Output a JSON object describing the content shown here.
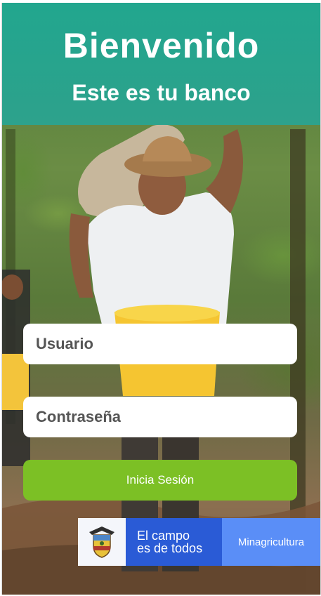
{
  "header": {
    "title": "Bienvenido",
    "subtitle": "Este es tu banco"
  },
  "login": {
    "username_placeholder": "Usuario",
    "password_placeholder": "Contraseña",
    "submit_label": "Inicia Sesión"
  },
  "banner": {
    "slogan_line1": "El campo",
    "slogan_line2": "es de todos",
    "ministry": "Minagricultura"
  },
  "colors": {
    "header_teal": "#1eaa96",
    "button_green": "#7cc025",
    "banner_blue": "#2a5bd6",
    "banner_light_blue": "#5a8ef7"
  }
}
